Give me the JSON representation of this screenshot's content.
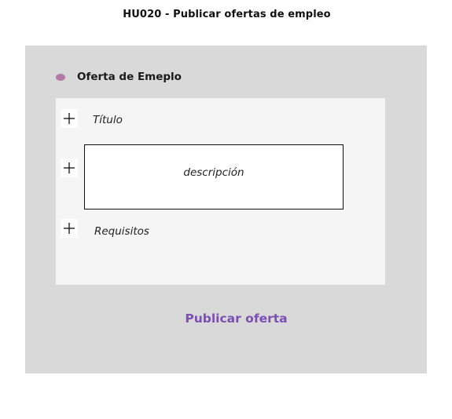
{
  "page": {
    "title": "HU020 - Publicar ofertas de empleo"
  },
  "frame": {
    "section_label": "Oferta de Emeplo",
    "status_dot_color": "#b47aa6"
  },
  "form": {
    "fields": [
      {
        "label": "Título",
        "add_icon": "plus-icon"
      },
      {
        "label": "descripción",
        "add_icon": "plus-icon"
      },
      {
        "label": "Requisitos",
        "add_icon": "plus-icon"
      }
    ]
  },
  "actions": {
    "publish_label": "Publicar oferta",
    "publish_color": "#7b4fb3"
  }
}
